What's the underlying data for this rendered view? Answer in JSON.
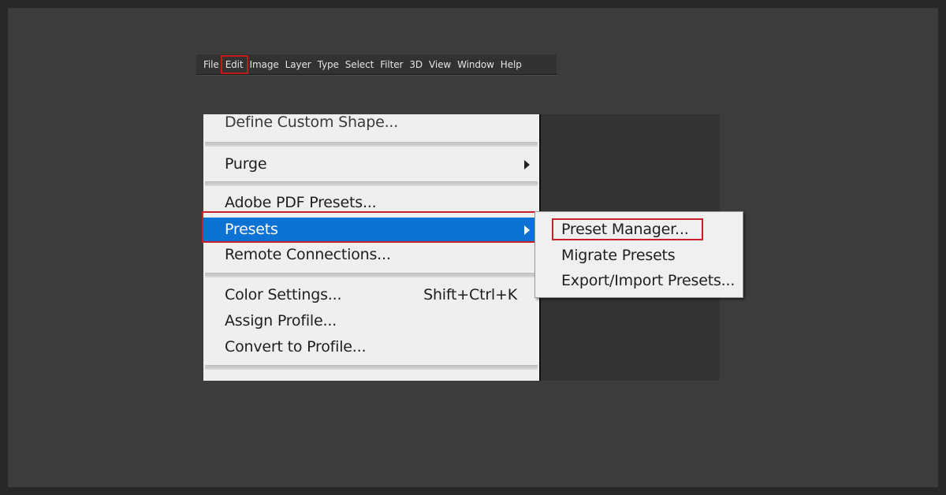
{
  "menubar": {
    "items": [
      "File",
      "Edit",
      "Image",
      "Layer",
      "Type",
      "Select",
      "Filter",
      "3D",
      "View",
      "Window",
      "Help"
    ],
    "active": "Edit"
  },
  "edit_menu": {
    "define_custom_shape": "Define Custom Shape...",
    "purge": "Purge",
    "adobe_pdf_presets": "Adobe PDF Presets...",
    "presets": "Presets",
    "remote_connections": "Remote Connections...",
    "color_settings": "Color Settings...",
    "color_settings_shortcut": "Shift+Ctrl+K",
    "assign_profile": "Assign Profile...",
    "convert_to_profile": "Convert to Profile..."
  },
  "presets_submenu": {
    "preset_manager": "Preset Manager...",
    "migrate_presets": "Migrate Presets",
    "export_import_presets": "Export/Import Presets..."
  },
  "colors": {
    "selection_blue": "#0c72d4",
    "highlight_red": "#c8202a",
    "background": "#3c3c3c"
  }
}
